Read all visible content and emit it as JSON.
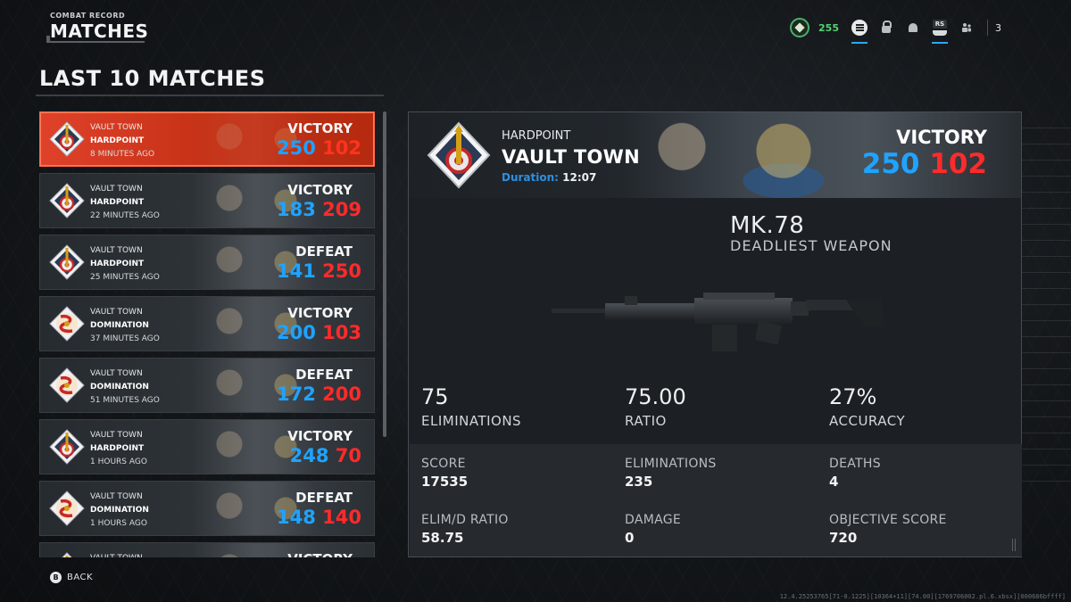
{
  "header": {
    "subtitle": "COMBAT RECORD",
    "title": "MATCHES"
  },
  "topbar": {
    "points": "255",
    "rs_label": "RS",
    "party_count": "3",
    "icons": [
      "rank-emblem-icon",
      "menu-icon",
      "lock-icon",
      "bell-icon",
      "rs-button-icon",
      "party-icon"
    ]
  },
  "list": {
    "title": "LAST 10 MATCHES",
    "matches": [
      {
        "map": "VAULT TOWN",
        "mode": "HARDPOINT",
        "time": "8 MINUTES AGO",
        "result": "VICTORY",
        "score_blue": "250",
        "score_red": "102",
        "emblem": "hardpoint-emblem-icon"
      },
      {
        "map": "VAULT TOWN",
        "mode": "HARDPOINT",
        "time": "22 MINUTES AGO",
        "result": "VICTORY",
        "score_blue": "183",
        "score_red": "209",
        "emblem": "hardpoint-emblem-icon"
      },
      {
        "map": "VAULT TOWN",
        "mode": "HARDPOINT",
        "time": "25 MINUTES AGO",
        "result": "DEFEAT",
        "score_blue": "141",
        "score_red": "250",
        "emblem": "hardpoint-emblem-icon"
      },
      {
        "map": "VAULT TOWN",
        "mode": "DOMINATION",
        "time": "37 MINUTES AGO",
        "result": "VICTORY",
        "score_blue": "200",
        "score_red": "103",
        "emblem": "domination-emblem-icon"
      },
      {
        "map": "VAULT TOWN",
        "mode": "DOMINATION",
        "time": "51 MINUTES AGO",
        "result": "DEFEAT",
        "score_blue": "172",
        "score_red": "200",
        "emblem": "domination-emblem-icon"
      },
      {
        "map": "VAULT TOWN",
        "mode": "HARDPOINT",
        "time": "1 HOURS AGO",
        "result": "VICTORY",
        "score_blue": "248",
        "score_red": "70",
        "emblem": "hardpoint-emblem-icon"
      },
      {
        "map": "VAULT TOWN",
        "mode": "DOMINATION",
        "time": "1 HOURS AGO",
        "result": "DEFEAT",
        "score_blue": "148",
        "score_red": "140",
        "emblem": "domination-emblem-icon"
      },
      {
        "map": "VAULT TOWN",
        "mode": "",
        "time": "",
        "result": "VICTORY",
        "score_blue": "",
        "score_red": "",
        "emblem": "hardpoint-emblem-icon"
      }
    ]
  },
  "detail": {
    "mode": "HARDPOINT",
    "map": "VAULT TOWN",
    "duration_label": "Duration:",
    "duration": "12:07",
    "result": "VICTORY",
    "score_blue": "250",
    "score_red": "102",
    "weapon_name": "MK.78",
    "weapon_caption": "DEADLIEST WEAPON",
    "weapon_icon": "light-machine-gun-image",
    "big_stats": [
      {
        "value": "75",
        "label": "ELIMINATIONS"
      },
      {
        "value": "75.00",
        "label": "RATIO"
      },
      {
        "value": "27%",
        "label": "ACCURACY"
      }
    ],
    "stats": [
      {
        "label": "SCORE",
        "value": "17535"
      },
      {
        "label": "ELIMINATIONS",
        "value": "235"
      },
      {
        "label": "DEATHS",
        "value": "4"
      },
      {
        "label": "ELIM/D RATIO",
        "value": "58.75"
      },
      {
        "label": "DAMAGE",
        "value": "0"
      },
      {
        "label": "OBJECTIVE SCORE",
        "value": "720"
      }
    ]
  },
  "footer": {
    "back_button": "B",
    "back_label": "BACK",
    "build": "12.4.25253765[71-0.1225][10364+11][74.00][1769706002.pl.6.xbsx][000686bffff]"
  },
  "colors": {
    "team_blue": "#1fa3ff",
    "team_red": "#ff2a2a",
    "selected_card": "#d63a1f",
    "points_green": "#55d26e"
  }
}
